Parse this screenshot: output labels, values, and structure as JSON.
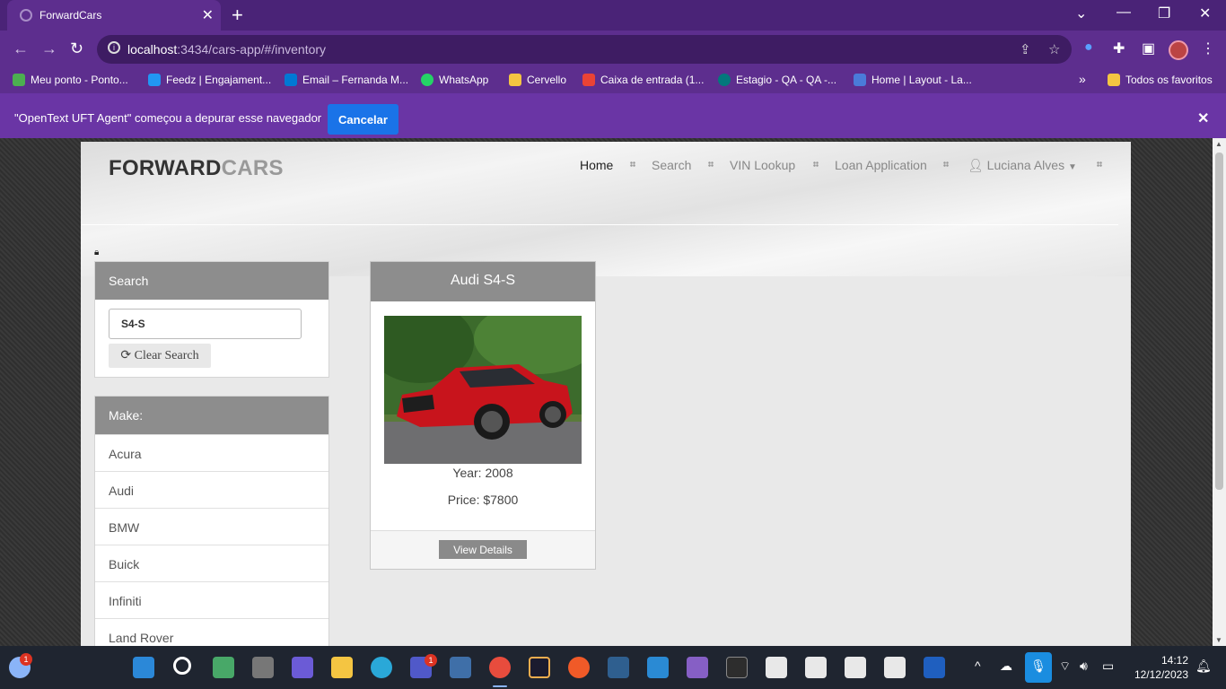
{
  "browser": {
    "tab_title": "ForwardCars",
    "url_host": "localhost",
    "url_rest": ":3434/cars-app/#/inventory",
    "bookmarks": [
      {
        "label": "Meu ponto - Ponto...",
        "color": "#4caf50"
      },
      {
        "label": "Feedz | Engajament...",
        "color": "#2196f3"
      },
      {
        "label": "Email – Fernanda M...",
        "color": "#0078d4"
      },
      {
        "label": "WhatsApp",
        "color": "#25d366"
      },
      {
        "label": "Cervello",
        "color": "#f4c542"
      },
      {
        "label": "Caixa de entrada (1...",
        "color": "#ea4335"
      },
      {
        "label": "Estagio - QA - QA -...",
        "color": "#03787c"
      },
      {
        "label": "Home | Layout - La...",
        "color": "#4a7bd9"
      }
    ],
    "more_bookmarks": "»",
    "all_bookmarks": "Todos os favoritos",
    "infobar_message": "\"OpenText UFT Agent\" começou a depurar esse navegador",
    "infobar_cancel": "Cancelar"
  },
  "site": {
    "logo_a": "FORWARD",
    "logo_b": "CARS",
    "nav": {
      "home": "Home",
      "search": "Search",
      "vin": "VIN Lookup",
      "loan": "Loan Application",
      "user": "Luciana Alves"
    },
    "search_panel": {
      "title": "Search",
      "value": "S4-S",
      "clear": "Clear Search"
    },
    "make_panel": {
      "title": "Make:",
      "items": [
        "Acura",
        "Audi",
        "BMW",
        "Buick",
        "Infiniti",
        "Land Rover"
      ]
    },
    "card": {
      "title": "Audi S4-S",
      "year": "Year: 2008",
      "price": "Price: $7800",
      "button": "View Details"
    }
  },
  "taskbar": {
    "time": "14:12",
    "date": "12/12/2023",
    "weather_badge": "1",
    "teams_badge": "1"
  }
}
